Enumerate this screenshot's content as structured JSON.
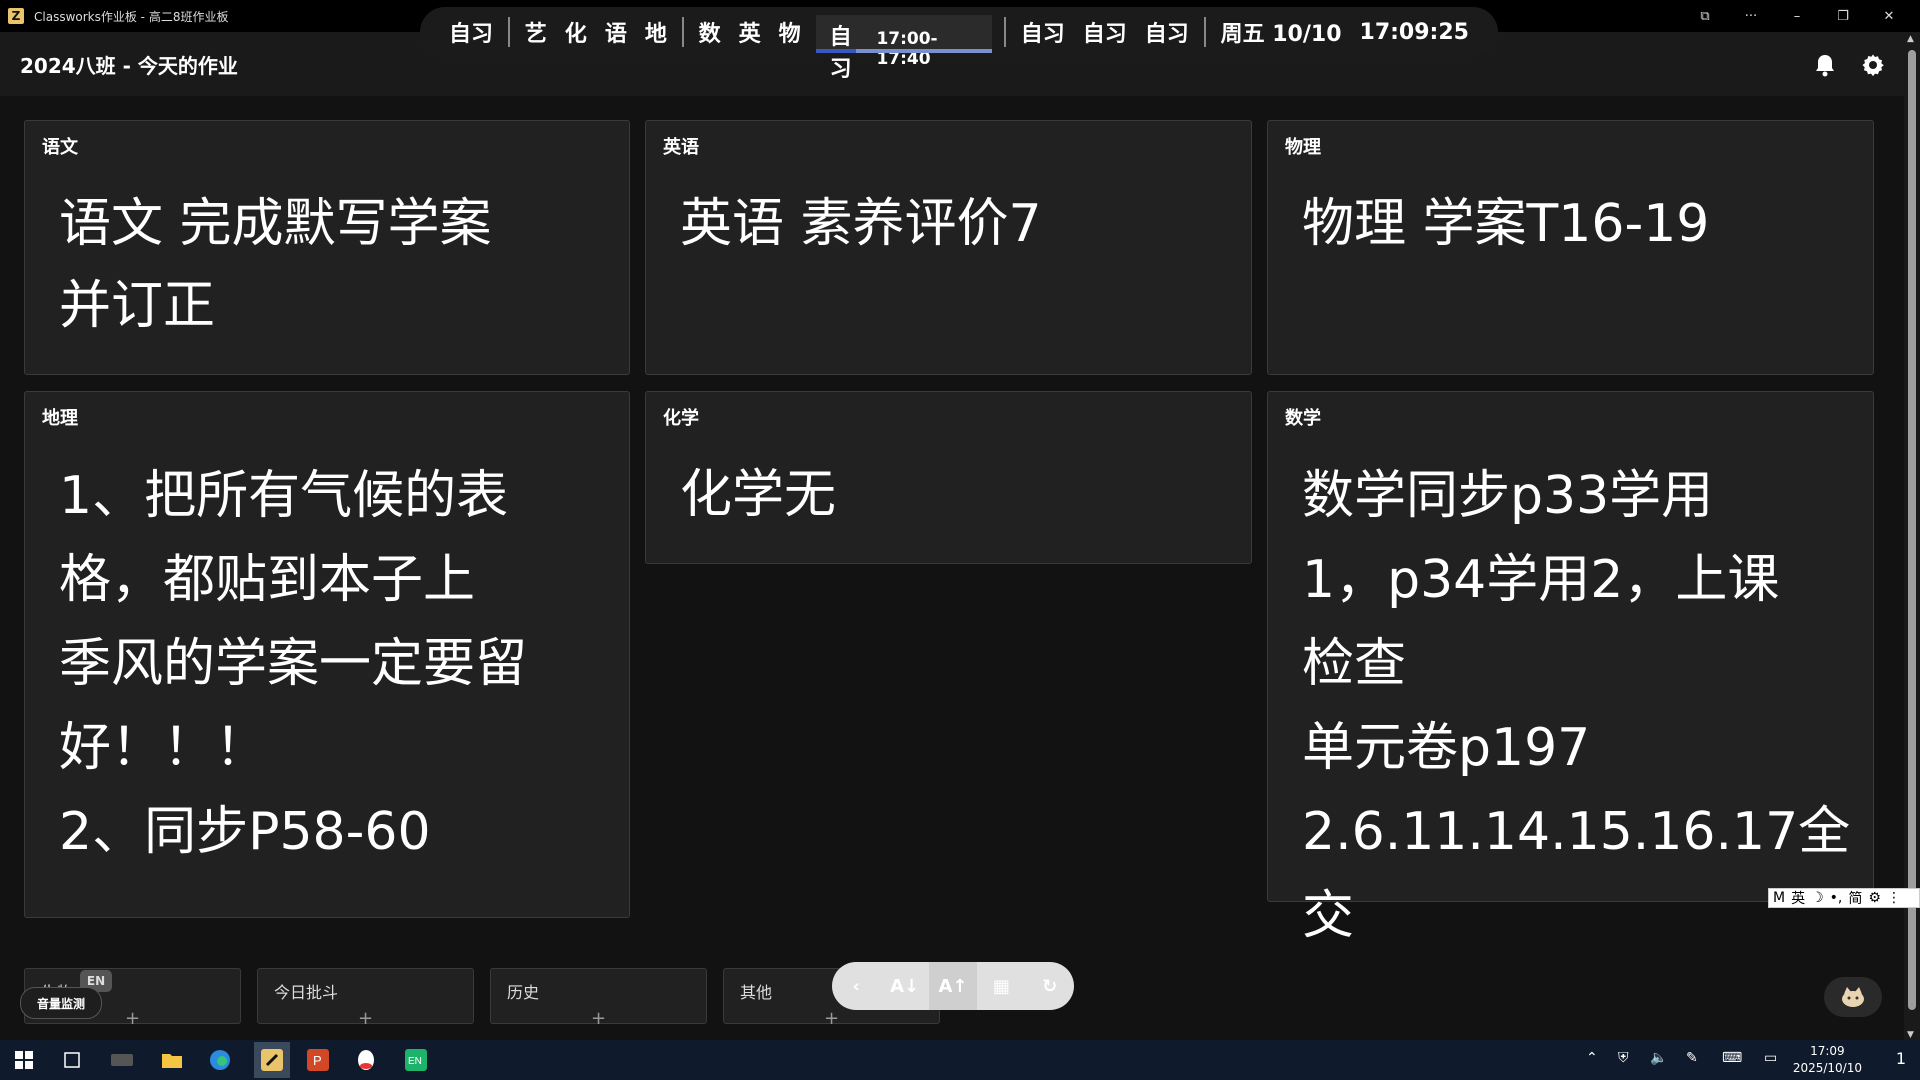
{
  "window": {
    "title": "Classworks作业板 - 高二8班作业板",
    "controls": [
      "⧉",
      "···",
      "–",
      "❐",
      "✕"
    ]
  },
  "schedule": {
    "groups": [
      [
        "自习"
      ],
      [
        "艺",
        "化",
        "语",
        "地"
      ],
      [
        "数",
        "英",
        "物"
      ]
    ],
    "current": {
      "label": "自习",
      "time": "17:00-17:40",
      "progress_percent": 23
    },
    "after": [
      "自习",
      "自习",
      "自习"
    ],
    "date": "周五 10/10",
    "clock": "17:09:25"
  },
  "header": {
    "title": "2024八班 - 今天的作业",
    "notification_icon": "bell-icon",
    "settings_icon": "gear-icon"
  },
  "cards": [
    {
      "subject": "语文",
      "content": "语文 完成默写学案\n并订正"
    },
    {
      "subject": "英语",
      "content": "英语 素养评价7"
    },
    {
      "subject": "物理",
      "content": "物理 学案T16-19"
    },
    {
      "subject": "地理",
      "content": "1、把所有气候的表\n格，都贴到本子上\n季风的学案一定要留\n好！！！\n2、同步P58-60"
    },
    {
      "subject": "化学",
      "content": "化学无"
    },
    {
      "subject": "数学",
      "content": "数学同步p33学用\n1，p34学用2，上课\n检查\n单元卷p197\n2.6.11.14.15.16.17全交"
    }
  ],
  "bottom": {
    "panels": [
      {
        "title": "生物"
      },
      {
        "title": "今日批斗"
      },
      {
        "title": "历史"
      },
      {
        "title": "其他"
      }
    ],
    "add_symbol": "+",
    "volume_label": "音量监测",
    "lang_badge": "EN",
    "toolbar": [
      "‹",
      "A↓",
      "A↑",
      "▦",
      "↻"
    ]
  },
  "ime": {
    "items": [
      "M",
      "英",
      "☽",
      "•,",
      "简",
      "⚙",
      "⋮"
    ]
  },
  "taskbar": {
    "time": "17:09",
    "date": "2025/10/10",
    "notification_count": "1"
  }
}
